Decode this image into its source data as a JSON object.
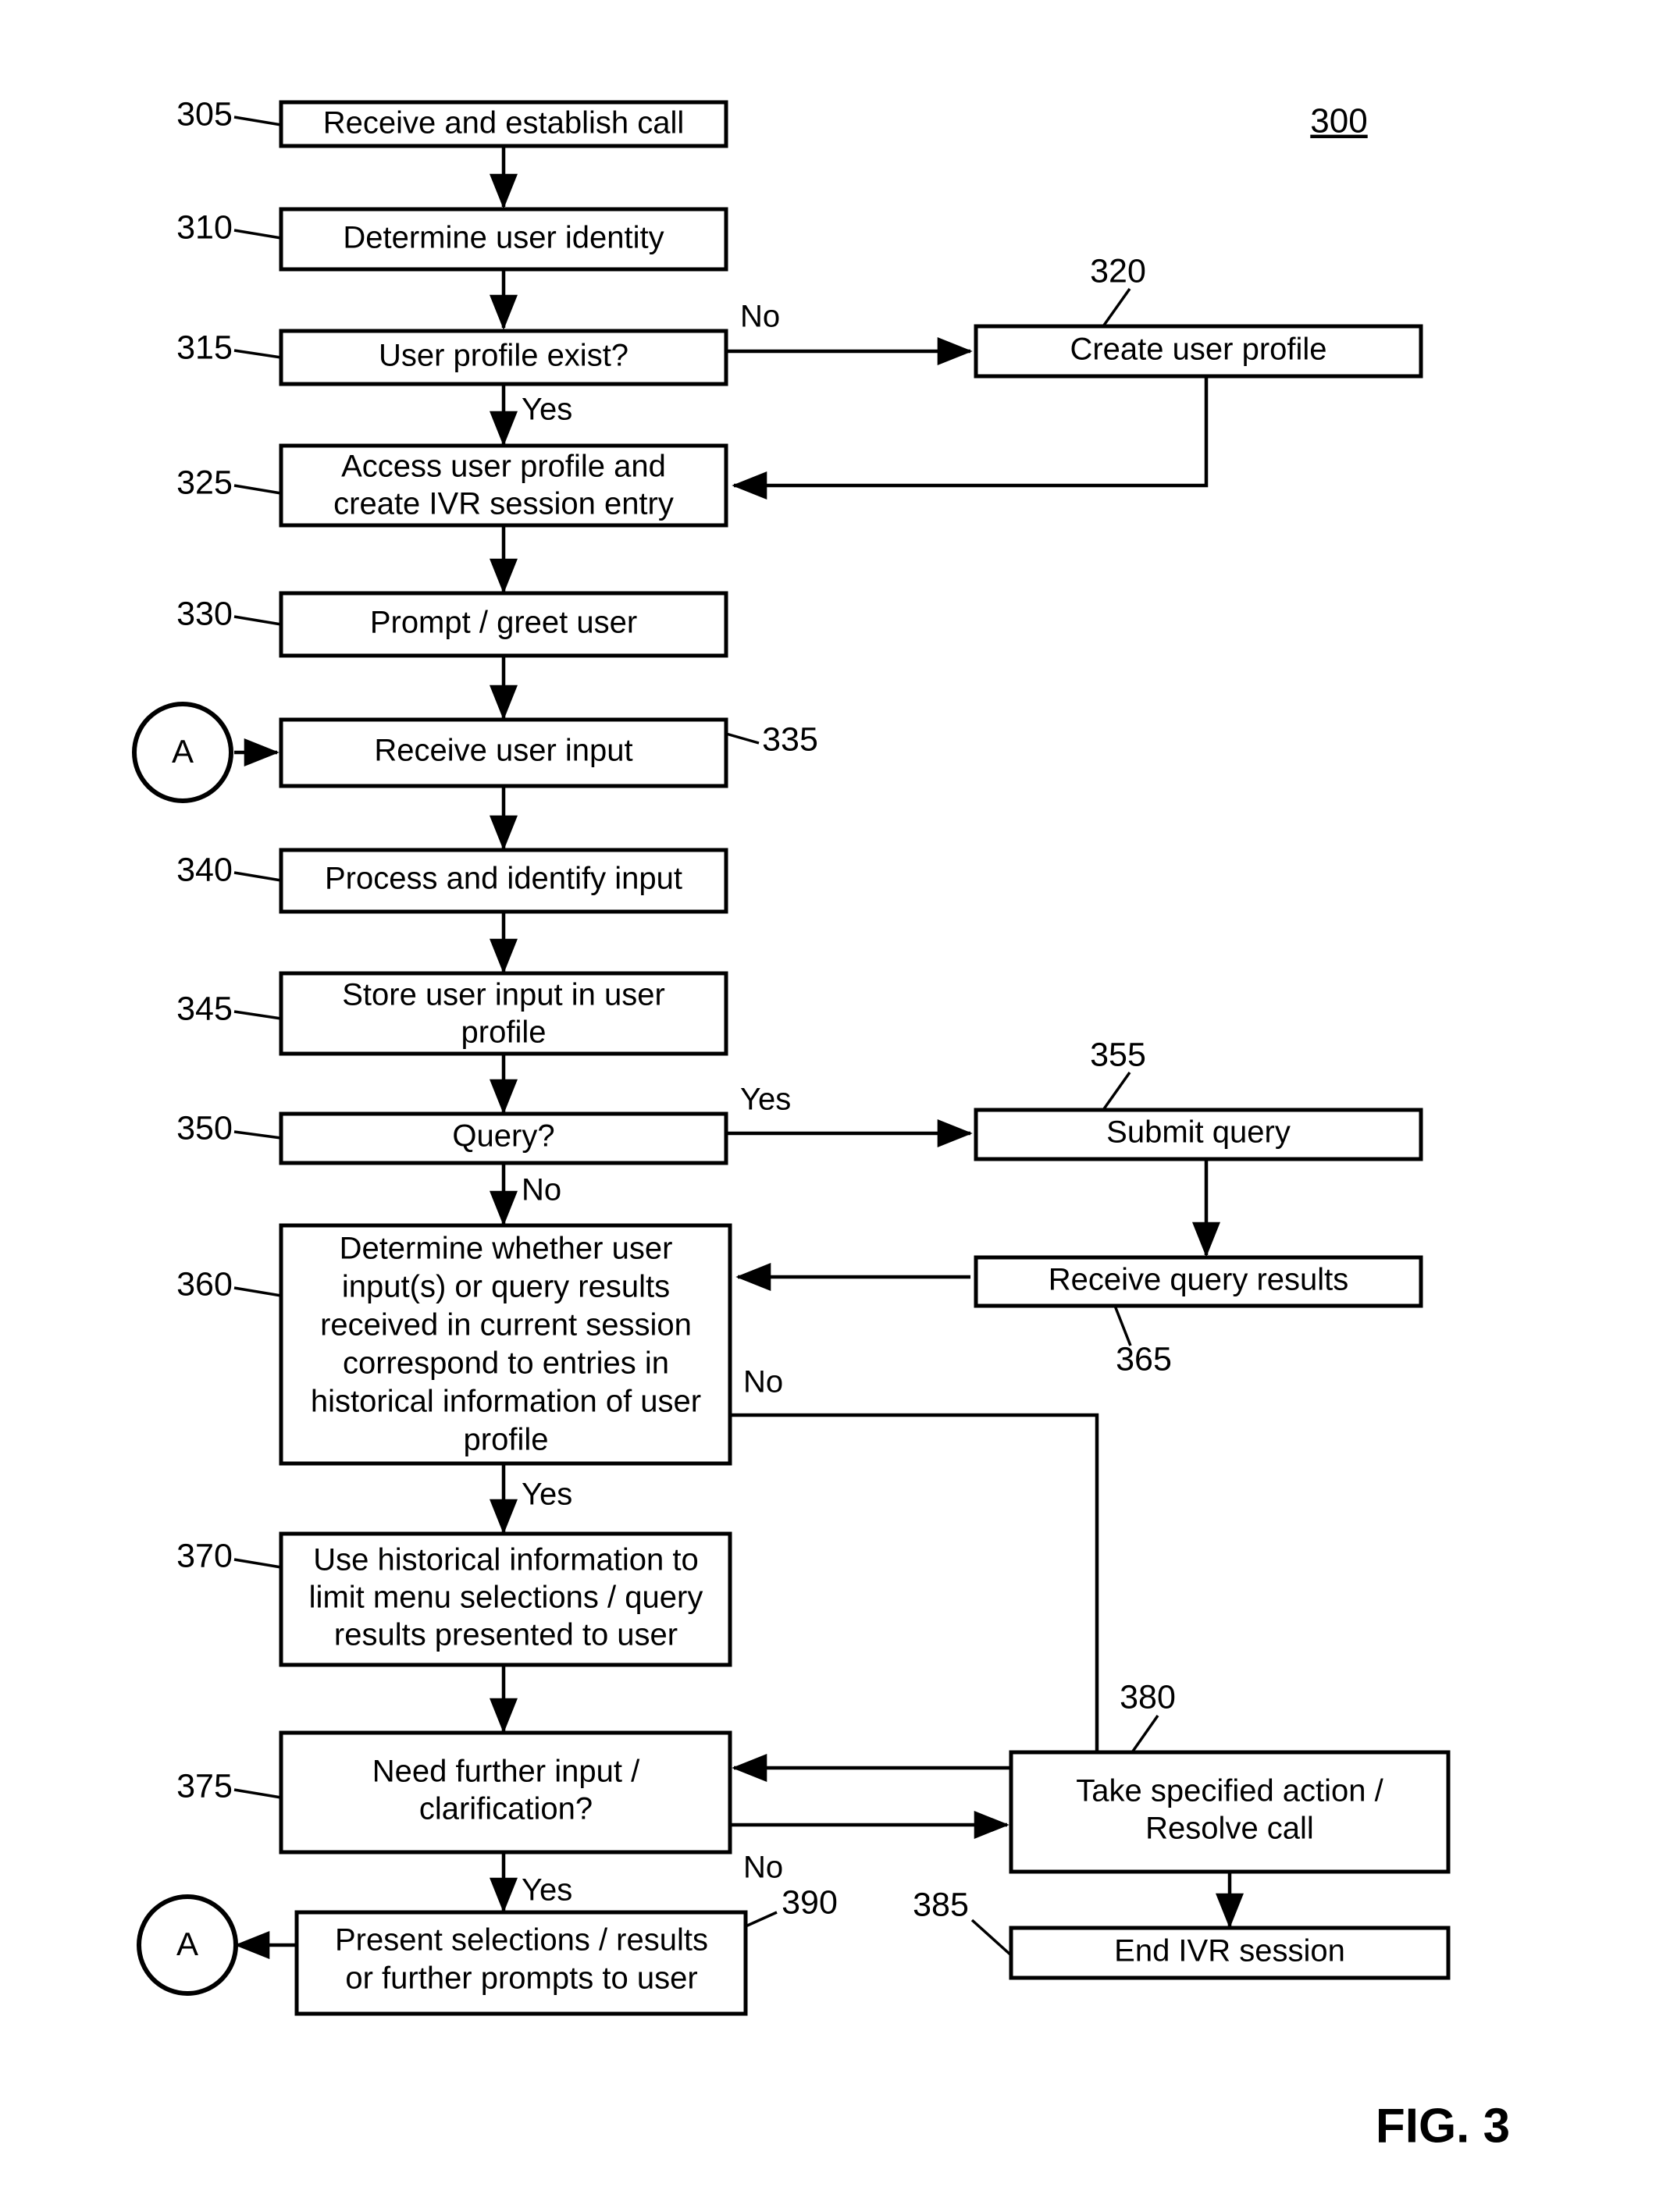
{
  "figure": {
    "caption": "FIG. 3",
    "diagram_number": "300"
  },
  "connectors": {
    "on_page_a_top": "A",
    "on_page_a_bottom": "A"
  },
  "branch_labels": {
    "b315_no": "No",
    "b315_yes": "Yes",
    "b350_yes": "Yes",
    "b350_no": "No",
    "b360_no": "No",
    "b360_yes": "Yes",
    "b375_yes": "Yes",
    "b375_no": "No"
  },
  "nodes": [
    {
      "ref": "305",
      "lines": [
        "Receive and establish call"
      ]
    },
    {
      "ref": "310",
      "lines": [
        "Determine user identity"
      ]
    },
    {
      "ref": "315",
      "lines": [
        "User profile exist?"
      ]
    },
    {
      "ref": "320",
      "lines": [
        "Create user profile"
      ]
    },
    {
      "ref": "325",
      "lines": [
        "Access user profile and",
        "create IVR session entry"
      ]
    },
    {
      "ref": "330",
      "lines": [
        "Prompt / greet user"
      ]
    },
    {
      "ref": "335",
      "lines": [
        "Receive user input"
      ]
    },
    {
      "ref": "340",
      "lines": [
        "Process and identify input"
      ]
    },
    {
      "ref": "345",
      "lines": [
        "Store user input in user",
        "profile"
      ]
    },
    {
      "ref": "350",
      "lines": [
        "Query?"
      ]
    },
    {
      "ref": "355",
      "lines": [
        "Submit query"
      ]
    },
    {
      "ref": "360",
      "lines": [
        "Determine whether user",
        "input(s) or query results",
        "received in current session",
        "correspond to entries in",
        "historical information of user",
        "profile"
      ]
    },
    {
      "ref": "365",
      "lines": [
        "Receive query results"
      ]
    },
    {
      "ref": "370",
      "lines": [
        "Use historical information to",
        "limit menu selections / query",
        "results presented to user"
      ]
    },
    {
      "ref": "375",
      "lines": [
        "Need further input /",
        "clarification?"
      ]
    },
    {
      "ref": "380",
      "lines": [
        "Take specified action /",
        "Resolve call"
      ]
    },
    {
      "ref": "385",
      "lines": [
        "End IVR session"
      ]
    },
    {
      "ref": "390",
      "lines": [
        "Present selections / results",
        "or further prompts to user"
      ]
    }
  ]
}
